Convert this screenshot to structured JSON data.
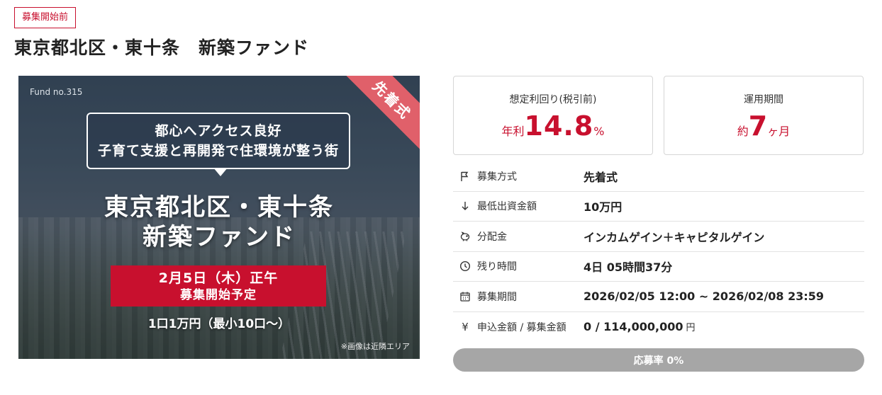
{
  "status_tag": "募集開始前",
  "page_title": "東京都北区・東十条　新築ファンド",
  "hero": {
    "fund_no": "Fund no.315",
    "badge": "先着式",
    "bubble_line1": "都心へアクセス良好",
    "bubble_line2": "子育て支援と再開発で住環境が整う街",
    "title_line1": "東京都北区・東十条",
    "title_line2": "新築ファンド",
    "date_line": "2月5日（木）正午",
    "start_line": "募集開始予定",
    "unit_line": "1口1万円（最小10口～）",
    "note": "※画像は近隣エリア"
  },
  "stats": {
    "yield": {
      "label": "想定利回り(税引前)",
      "prefix": "年利",
      "value": "14.8",
      "suffix": "%"
    },
    "period": {
      "label": "運用期間",
      "prefix": "約",
      "value": "7",
      "suffix": "ヶ月"
    }
  },
  "info": [
    {
      "icon": "flag-icon",
      "key": "募集方式",
      "value": "先着式"
    },
    {
      "icon": "arrow-down-icon",
      "key": "最低出資金額",
      "value": "10万円"
    },
    {
      "icon": "piggy-bank-icon",
      "key": "分配金",
      "value": "インカムゲイン＋キャピタルゲイン"
    },
    {
      "icon": "clock-icon",
      "key": "残り時間",
      "value": "4日 05時間37分"
    },
    {
      "icon": "calendar-icon",
      "key": "募集期間",
      "value": "2026/02/05 12:00 ~ 2026/02/08 23:59"
    },
    {
      "icon": "yen-icon",
      "key": "申込金額 / 募集金額",
      "value": "0 / 114,000,000",
      "unit": "円"
    }
  ],
  "progress": {
    "label": "応募率 0%",
    "percent": 0
  },
  "colors": {
    "accent": "#c8102e",
    "progress_bg": "#a6a6a6"
  }
}
